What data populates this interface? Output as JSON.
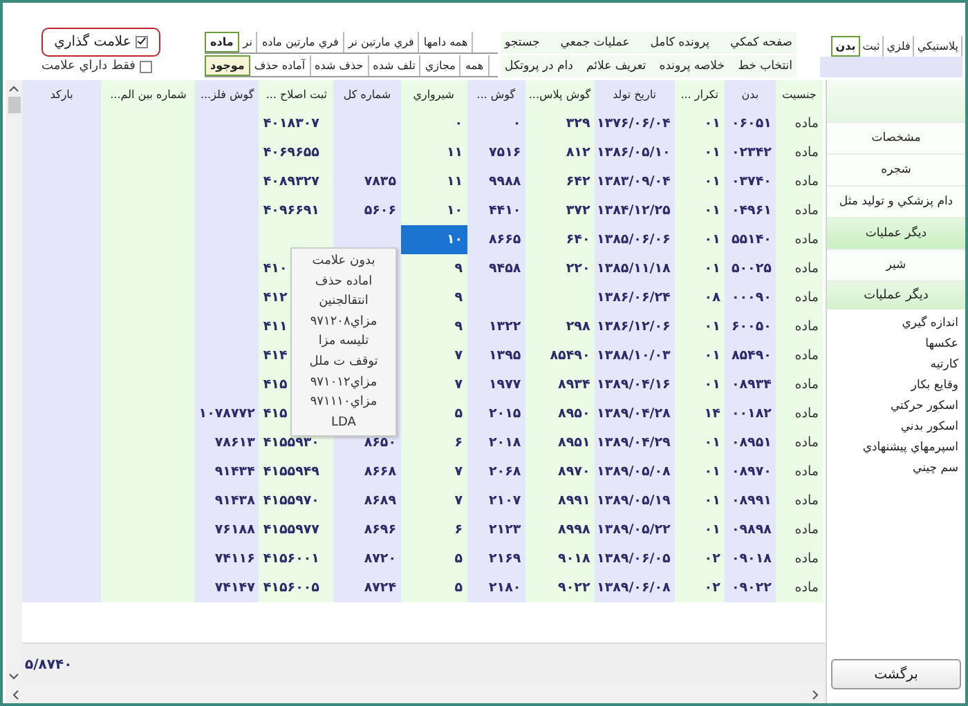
{
  "marking": {
    "label": "علامت گذاري",
    "checked": true
  },
  "only_marked": {
    "label": "فقط داراي علامت",
    "checked": false
  },
  "sex_tabs": [
    {
      "label": "همه دامها",
      "selected": false
    },
    {
      "label": "فري مارتين نر",
      "selected": false
    },
    {
      "label": "فري مارتين ماده",
      "selected": false
    },
    {
      "label": "نر",
      "selected": false
    },
    {
      "label": "ماده",
      "selected": true
    }
  ],
  "status_tabs": [
    {
      "label": "همه",
      "selected": false
    },
    {
      "label": "مجازي",
      "selected": false
    },
    {
      "label": "تلف شده",
      "selected": false
    },
    {
      "label": "حذف شده",
      "selected": false
    },
    {
      "label": "آماده حذف",
      "selected": false
    },
    {
      "label": "موجود",
      "selected": true
    }
  ],
  "actions_row1": [
    "صفحه كمكي",
    "پرونده كامل",
    "عمليات جمعي",
    "جستجو"
  ],
  "actions_row2": [
    "انتخاب خط",
    "خلاصه پرونده",
    "تعريف علائم",
    "دام در پروتكل"
  ],
  "view_tabs": [
    {
      "label": "پلاستيكي",
      "selected": false
    },
    {
      "label": "فلزي",
      "selected": false
    },
    {
      "label": "ثبت",
      "selected": false
    },
    {
      "label": "بدن",
      "selected": true
    }
  ],
  "table": {
    "columns": [
      "جنسيت",
      "بدن",
      "تكرار ...",
      "تاريخ تولد",
      "گوش پلاس...",
      "گوش ...",
      "شيرواري",
      "شماره كل",
      "ثبت اصلاح ...",
      "گوش فلز...",
      "شماره بين الم...",
      "باركد"
    ],
    "rows": [
      {
        "selected": false,
        "cells": [
          "ماده",
          "۰۶۰۵۱",
          "۰۱",
          "۱۳۷۶/۰۶/۰۴",
          "۳۲۹",
          "۰",
          "۰",
          null,
          "۴۰۱۸۳۰۷",
          null,
          null,
          null
        ]
      },
      {
        "selected": false,
        "cells": [
          "ماده",
          "۰۲۳۴۲",
          "۰۱",
          "۱۳۸۶/۰۵/۱۰",
          "۸۱۲",
          "۷۵۱۶",
          "۱۱",
          null,
          "۴۰۶۹۶۵۵",
          null,
          null,
          null
        ]
      },
      {
        "selected": false,
        "cells": [
          "ماده",
          "۰۳۷۴۰",
          "۰۱",
          "۱۳۸۳/۰۹/۰۴",
          "۶۴۲",
          "۹۹۸۸",
          "۱۱",
          "۷۸۳۵",
          "۴۰۸۹۳۲۷",
          null,
          null,
          null
        ]
      },
      {
        "selected": false,
        "cells": [
          "ماده",
          "۰۴۹۶۱",
          "۰۱",
          "۱۳۸۴/۱۲/۲۵",
          "۳۷۲",
          "۴۴۱۰",
          "۱۰",
          "۵۶۰۶",
          "۴۰۹۶۶۹۱",
          null,
          null,
          null
        ]
      },
      {
        "selected": true,
        "cells": [
          "ماده",
          "۵۵۱۴۰",
          "۰۱",
          "۱۳۸۵/۰۶/۰۶",
          "۶۴۰",
          "۸۶۶۵",
          "۱۰",
          null,
          null,
          null,
          null,
          null
        ]
      },
      {
        "selected": false,
        "cells": [
          "ماده",
          "۵۰۰۲۵",
          "۰۱",
          "۱۳۸۵/۱۱/۱۸",
          "۲۲۰",
          "۹۴۵۸",
          "۹",
          null,
          "۴۱۰",
          null,
          null,
          null
        ]
      },
      {
        "selected": false,
        "cells": [
          "ماده",
          "۰۰۰۹۰",
          "۰۸",
          "۱۳۸۶/۰۶/۲۴",
          null,
          null,
          "۹",
          null,
          "۴۱۲",
          null,
          null,
          null
        ]
      },
      {
        "selected": false,
        "cells": [
          "ماده",
          "۶۰۰۵۰",
          "۰۱",
          "۱۳۸۶/۱۲/۰۶",
          "۲۹۸",
          "۱۳۲۲",
          "۹",
          null,
          "۴۱۱",
          null,
          null,
          null
        ]
      },
      {
        "selected": false,
        "cells": [
          "ماده",
          "۸۵۴۹۰",
          "۰۱",
          "۱۳۸۸/۱۰/۰۳",
          "۸۵۴۹۰",
          "۱۳۹۵",
          "۷",
          null,
          "۴۱۴",
          null,
          null,
          null
        ]
      },
      {
        "selected": false,
        "cells": [
          "ماده",
          "۰۸۹۳۴",
          "۰۱",
          "۱۳۸۹/۰۴/۱۶",
          "۸۹۳۴",
          "۱۹۷۷",
          "۷",
          null,
          "۴۱۵",
          null,
          null,
          null
        ]
      },
      {
        "selected": false,
        "cells": [
          "ماده",
          "۰۰۱۸۲",
          "۱۴",
          "۱۳۸۹/۰۴/۲۸",
          "۸۹۵۰",
          "۲۰۱۵",
          "۵",
          null,
          "۴۱۵",
          "۱۰۷۸۷۷۲",
          null,
          null
        ]
      },
      {
        "selected": false,
        "cells": [
          "ماده",
          "۰۸۹۵۱",
          "۰۱",
          "۱۳۸۹/۰۴/۲۹",
          "۸۹۵۱",
          "۲۰۱۸",
          "۶",
          "۸۶۵۰",
          "۴۱۵۵۹۳۰",
          "۷۸۶۱۳",
          null,
          null
        ]
      },
      {
        "selected": false,
        "cells": [
          "ماده",
          "۰۸۹۷۰",
          "۰۱",
          "۱۳۸۹/۰۵/۰۸",
          "۸۹۷۰",
          "۲۰۶۸",
          "۷",
          "۸۶۶۸",
          "۴۱۵۵۹۴۹",
          "۹۱۴۳۴",
          null,
          null
        ]
      },
      {
        "selected": false,
        "cells": [
          "ماده",
          "۰۸۹۹۱",
          "۰۱",
          "۱۳۸۹/۰۵/۱۹",
          "۸۹۹۱",
          "۲۱۰۷",
          "۷",
          "۸۶۸۹",
          "۴۱۵۵۹۷۰",
          "۹۱۴۳۸",
          null,
          null
        ]
      },
      {
        "selected": false,
        "cells": [
          "ماده",
          "۰۹۸۹۸",
          "۰۱",
          "۱۳۸۹/۰۵/۲۲",
          "۸۹۹۸",
          "۲۱۲۳",
          "۶",
          "۸۶۹۶",
          "۴۱۵۵۹۷۷",
          "۷۶۱۸۸",
          null,
          null
        ]
      },
      {
        "selected": false,
        "cells": [
          "ماده",
          "۰۹۰۱۸",
          "۰۲",
          "۱۳۸۹/۰۶/۰۵",
          "۹۰۱۸",
          "۲۱۶۹",
          "۵",
          "۸۷۲۰",
          "۴۱۵۶۰۰۱",
          "۷۴۱۱۶",
          null,
          null
        ]
      },
      {
        "selected": false,
        "cells": [
          "ماده",
          "۰۹۰۲۲",
          "۰۲",
          "۱۳۸۹/۰۶/۰۸",
          "۹۰۲۲",
          "۲۱۸۰",
          "۵",
          "۸۷۲۴",
          "۴۱۵۶۰۰۵",
          "۷۴۱۴۷",
          null,
          null
        ]
      }
    ]
  },
  "context_menu": {
    "items": [
      "بدون علامت",
      "اماده حذف",
      "انتقالجنين",
      "مزاي۹۷۱۲۰۸",
      "تليسه مزا",
      "توقف ت ملل",
      "مزاي۹۷۱۰۱۲",
      "مزاي۹۷۱۱۱۰",
      "LDA"
    ]
  },
  "record_count": "۵/۸۷۴۰",
  "sidebar": {
    "sections": [
      {
        "label": "مشخصات",
        "selected": false
      },
      {
        "label": "شجره",
        "selected": false
      },
      {
        "label": "دام پزشكي و توليد مثل",
        "selected": false
      },
      {
        "label": "ديگر عمليات",
        "selected": true
      },
      {
        "label": "شير",
        "selected": false
      }
    ],
    "group": {
      "title": "ديگر عمليات",
      "items": [
        "اندازه گيري",
        "عكسها",
        "كارتيه",
        "وقايع بكار",
        "اسكور حركتي",
        "اسكور بدني",
        "اسپرمهاي پيشنهادي",
        "سم چيني"
      ]
    },
    "back_button": "برگشت"
  }
}
